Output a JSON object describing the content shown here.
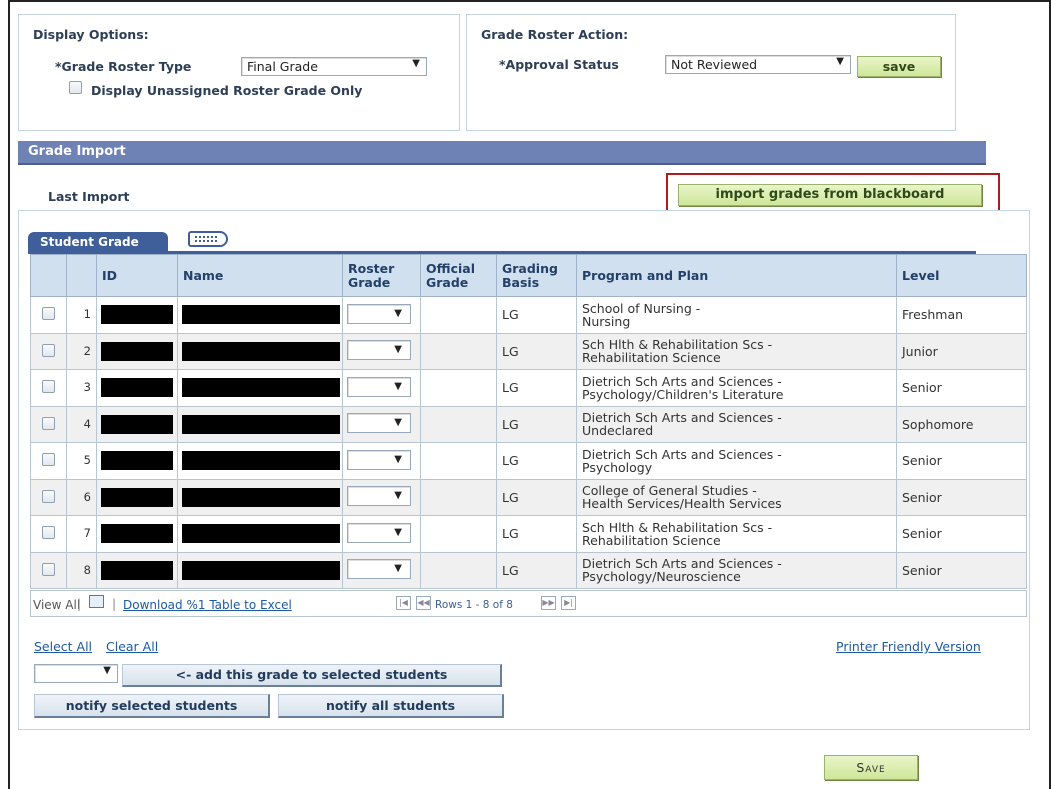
{
  "display_options": {
    "title": "Display Options:",
    "roster_type_label": "*Grade Roster Type",
    "roster_type_value": "Final Grade",
    "unassigned_label": "Display Unassigned Roster Grade Only"
  },
  "roster_action": {
    "title": "Grade Roster Action:",
    "approval_label": "*Approval Status",
    "approval_value": "Not Reviewed",
    "save_label": "save"
  },
  "grade_import": {
    "header": "Grade Import",
    "last_import_label": "Last Import",
    "import_button": "import grades from blackboard"
  },
  "grid": {
    "tab_label": "Student Grade",
    "columns": [
      "ID",
      "Name",
      "Roster Grade",
      "Official Grade",
      "Grading Basis",
      "Program and Plan",
      "Level"
    ],
    "rows": [
      {
        "num": "1",
        "basis": "LG",
        "program": "School of Nursing -",
        "plan": "Nursing",
        "level": "Freshman"
      },
      {
        "num": "2",
        "basis": "LG",
        "program": "Sch Hlth & Rehabilitation Scs -",
        "plan": "Rehabilitation Science",
        "level": "Junior"
      },
      {
        "num": "3",
        "basis": "LG",
        "program": "Dietrich Sch Arts and Sciences -",
        "plan": "Psychology/Children's Literature",
        "level": "Senior"
      },
      {
        "num": "4",
        "basis": "LG",
        "program": "Dietrich Sch Arts and Sciences -",
        "plan": "Undeclared",
        "level": "Sophomore"
      },
      {
        "num": "5",
        "basis": "LG",
        "program": "Dietrich Sch Arts and Sciences -",
        "plan": "Psychology",
        "level": "Senior"
      },
      {
        "num": "6",
        "basis": "LG",
        "program": "College of General Studies -",
        "plan": "Health Services/Health Services",
        "level": "Senior"
      },
      {
        "num": "7",
        "basis": "LG",
        "program": "Sch Hlth & Rehabilitation Scs -",
        "plan": "Rehabilitation Science",
        "level": "Senior"
      },
      {
        "num": "8",
        "basis": "LG",
        "program": "Dietrich Sch Arts and Sciences -",
        "plan": "Psychology/Neuroscience",
        "level": "Senior"
      }
    ],
    "footer": {
      "view_all": "View All",
      "download": "Download %1 Table to Excel",
      "rows_text": "Rows 1 - 8 of 8"
    }
  },
  "actions": {
    "select_all": "Select All",
    "clear_all": "Clear All",
    "printer_friendly": "Printer Friendly Version",
    "add_grade": "<- add this grade to selected students",
    "notify_selected": "notify selected students",
    "notify_all": "notify all students",
    "save_bottom": "Save"
  },
  "colors": {
    "header_band": "#6e82b5",
    "highlight_border": "#b01c1c",
    "button_green": "#cfe69a"
  }
}
